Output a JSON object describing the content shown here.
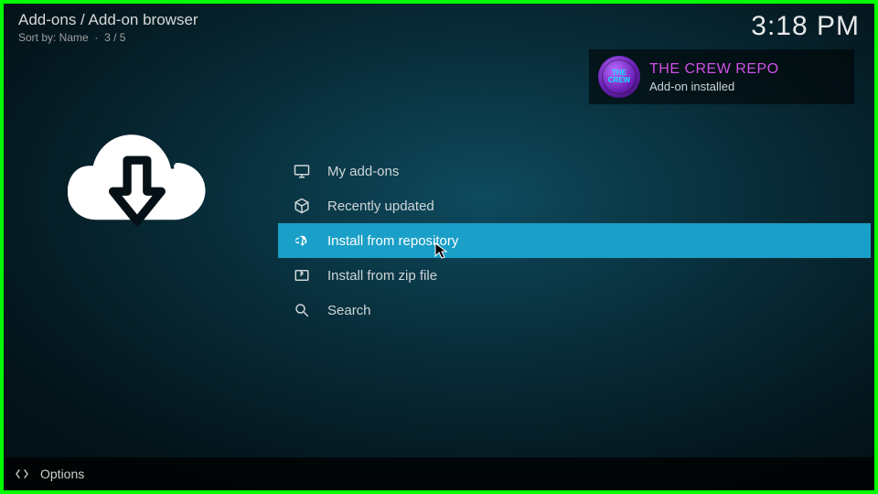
{
  "header": {
    "breadcrumb": "Add-ons / Add-on browser",
    "sort_label": "Sort by: Name",
    "position": "3 / 5"
  },
  "clock": "3:18 PM",
  "menu": {
    "items": [
      {
        "label": "My add-ons",
        "icon": "monitor-icon"
      },
      {
        "label": "Recently updated",
        "icon": "box-icon"
      },
      {
        "label": "Install from repository",
        "icon": "cloud-download-icon"
      },
      {
        "label": "Install from zip file",
        "icon": "zip-icon"
      },
      {
        "label": "Search",
        "icon": "search-icon"
      }
    ],
    "selected_index": 2
  },
  "notification": {
    "title": "THE CREW REPO",
    "subtitle": "Add-on installed",
    "badge_text": "THE\nCREW"
  },
  "footer": {
    "options_label": "Options"
  },
  "colors": {
    "accent": "#1aa0c8",
    "toast_title": "#d050e8",
    "frame": "#00ff00"
  }
}
